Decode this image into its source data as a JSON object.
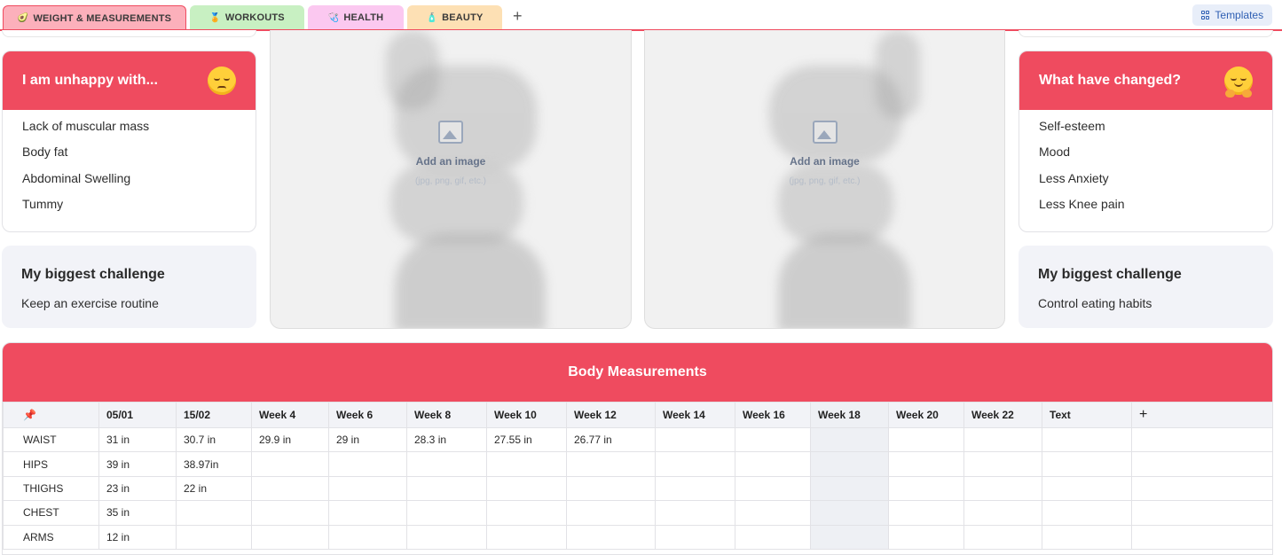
{
  "tabs": [
    {
      "label": "WEIGHT & MEASUREMENTS",
      "icon": "🥑"
    },
    {
      "label": "WORKOUTS",
      "icon": "🏅"
    },
    {
      "label": "HEALTH",
      "icon": "🩺"
    },
    {
      "label": "BEAUTY",
      "icon": "🧴"
    }
  ],
  "add_tab": "+",
  "templates_label": "Templates",
  "unhappy": {
    "title": "I am unhappy with...",
    "items": [
      "Lack of muscular mass",
      "Body fat",
      "Abdominal Swelling",
      "Tummy"
    ]
  },
  "changed": {
    "title": "What have changed?",
    "items": [
      "Self-esteem",
      "Mood",
      "Less Anxiety",
      "Less Knee pain"
    ]
  },
  "challenge_left": {
    "title": "My biggest challenge",
    "text": "Keep an exercise routine"
  },
  "challenge_right": {
    "title": "My biggest challenge",
    "text": "Control eating habits"
  },
  "photo_hint": {
    "title": "Add an image",
    "sub": "(jpg, png, gif, etc.)"
  },
  "table": {
    "title": "Body Measurements",
    "pin_icon": "📌",
    "columns": [
      "05/01",
      "15/02",
      "Week 4",
      "Week 6",
      "Week 8",
      "Week 10",
      "Week 12",
      "Week 14",
      "Week 16",
      "Week 18",
      "Week 20",
      "Week 22",
      "Text",
      "+"
    ],
    "rows": [
      {
        "label": "WAIST",
        "cells": [
          "31 in",
          "30.7 in",
          "29.9 in",
          "29 in",
          "28.3 in",
          "27.55 in",
          "26.77 in",
          "",
          "",
          "",
          "",
          "",
          "",
          ""
        ]
      },
      {
        "label": "HIPS",
        "cells": [
          "39 in",
          "38.97in",
          "",
          "",
          "",
          "",
          "",
          "",
          "",
          "",
          "",
          "",
          "",
          ""
        ]
      },
      {
        "label": "THIGHS",
        "cells": [
          "23 in",
          "22 in",
          "",
          "",
          "",
          "",
          "",
          "",
          "",
          "",
          "",
          "",
          "",
          ""
        ]
      },
      {
        "label": "CHEST",
        "cells": [
          "35 in",
          "",
          "",
          "",
          "",
          "",
          "",
          "",
          "",
          "",
          "",
          "",
          "",
          ""
        ]
      },
      {
        "label": "ARMS",
        "cells": [
          "12 in",
          "",
          "",
          "",
          "",
          "",
          "",
          "",
          "",
          "",
          "",
          "",
          "",
          ""
        ]
      }
    ]
  },
  "colors": {
    "accent": "#ef4b5f",
    "grey_card": "#f2f3f8"
  }
}
